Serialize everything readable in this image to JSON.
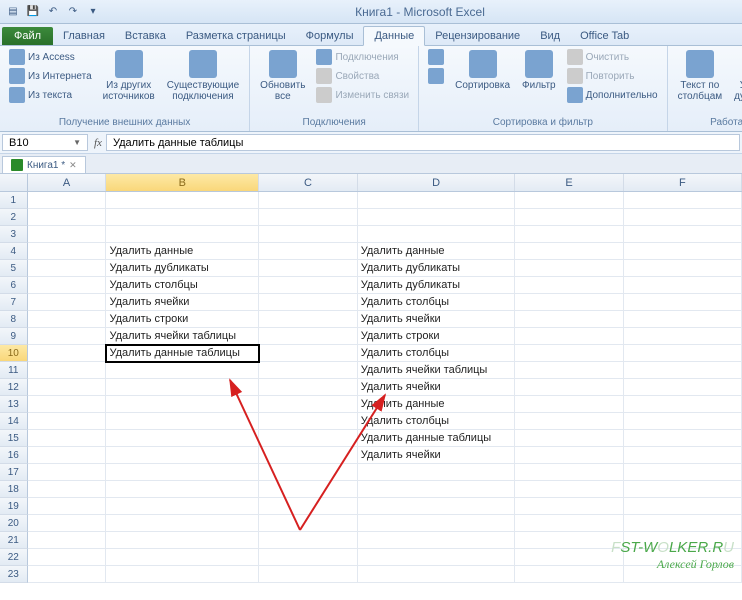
{
  "title": "Книга1 - Microsoft Excel",
  "file_tab": "Файл",
  "tabs": [
    "Главная",
    "Вставка",
    "Разметка страницы",
    "Формулы",
    "Данные",
    "Рецензирование",
    "Вид",
    "Office Tab"
  ],
  "active_tab_index": 4,
  "ribbon": {
    "group1": {
      "access": "Из Access",
      "internet": "Из Интернета",
      "text": "Из текста",
      "other": "Из других\nисточников",
      "existing": "Существующие\nподключения",
      "label": "Получение внешних данных"
    },
    "group2": {
      "refresh": "Обновить\nвсе",
      "conn": "Подключения",
      "props": "Свойства",
      "editlinks": "Изменить связи",
      "label": "Подключения"
    },
    "group3": {
      "sortaz": "А↓Я",
      "sortza": "Я↓А",
      "sort": "Сортировка",
      "filter": "Фильтр",
      "clear": "Очистить",
      "reapply": "Повторить",
      "advanced": "Дополнительно",
      "label": "Сортировка и фильтр"
    },
    "group4": {
      "texttocol": "Текст по\nстолбцам",
      "removedup": "Удалить\nдубликаты",
      "label": "Работа с"
    }
  },
  "namebox": "B10",
  "formula": "Удалить данные таблицы",
  "doc_tab": "Книга1 *",
  "cols": {
    "A": 80,
    "B": 155,
    "C": 100,
    "D": 160,
    "E": 110,
    "F": 120
  },
  "col_letters": [
    "A",
    "B",
    "C",
    "D",
    "E",
    "F"
  ],
  "selected_cell": {
    "row": 10,
    "col": "B"
  },
  "selected_col": "B",
  "selected_row": 10,
  "row_count": 23,
  "chart_data": {
    "type": "table",
    "columns": [
      "B",
      "D"
    ],
    "rows": [
      {
        "r": 4,
        "B": "Удалить данные",
        "D": "Удалить данные"
      },
      {
        "r": 5,
        "B": "Удалить дубликаты",
        "D": "Удалить дубликаты"
      },
      {
        "r": 6,
        "B": "Удалить столбцы",
        "D": "Удалить дубликаты"
      },
      {
        "r": 7,
        "B": "Удалить ячейки",
        "D": "Удалить столбцы"
      },
      {
        "r": 8,
        "B": "Удалить строки",
        "D": "Удалить ячейки"
      },
      {
        "r": 9,
        "B": "Удалить ячейки таблицы",
        "D": "Удалить строки"
      },
      {
        "r": 10,
        "B": "Удалить данные таблицы",
        "D": "Удалить столбцы"
      },
      {
        "r": 11,
        "B": "",
        "D": "Удалить ячейки таблицы"
      },
      {
        "r": 12,
        "B": "",
        "D": "Удалить ячейки"
      },
      {
        "r": 13,
        "B": "",
        "D": "Удалить данные"
      },
      {
        "r": 14,
        "B": "",
        "D": "Удалить столбцы"
      },
      {
        "r": 15,
        "B": "",
        "D": "Удалить данные таблицы"
      },
      {
        "r": 16,
        "B": "",
        "D": "Удалить ячейки"
      }
    ]
  },
  "watermark": {
    "line1a": "F",
    "line1b": "ST-W",
    "line1c": "LKER.R",
    "line2": "Алексей Горлов"
  }
}
